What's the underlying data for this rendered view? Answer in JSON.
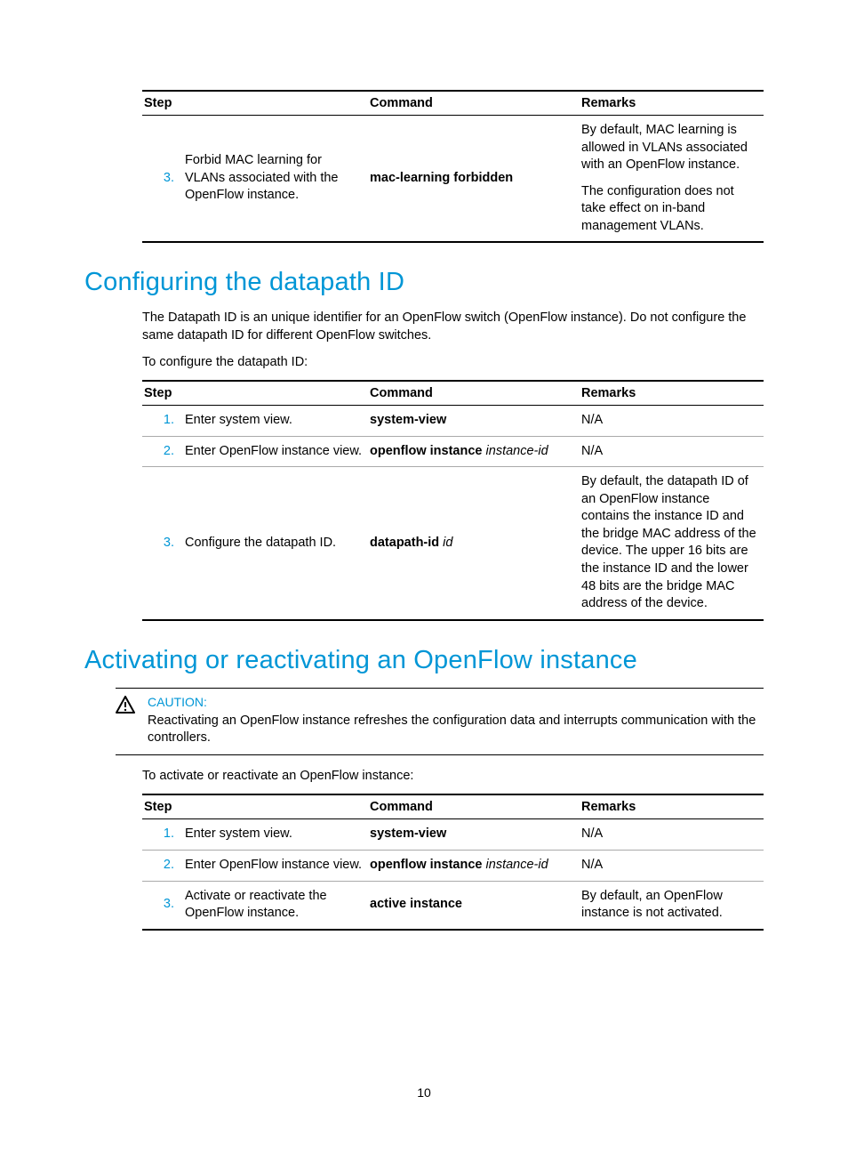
{
  "table1": {
    "headers": {
      "step": "Step",
      "command": "Command",
      "remarks": "Remarks"
    },
    "rows": [
      {
        "num": "3.",
        "step": "Forbid MAC learning for VLANs associated with the OpenFlow instance.",
        "cmd_bold": "mac-learning forbidden",
        "remarks_a": "By default, MAC learning is allowed in VLANs associated with an OpenFlow instance.",
        "remarks_b": "The configuration does not take effect on in-band management VLANs."
      }
    ]
  },
  "section1": {
    "heading": "Configuring the datapath ID",
    "para1": "The Datapath ID is an unique identifier for an OpenFlow switch (OpenFlow instance). Do not configure the same datapath ID for different OpenFlow switches.",
    "para2": "To configure the datapath ID:"
  },
  "table2": {
    "headers": {
      "step": "Step",
      "command": "Command",
      "remarks": "Remarks"
    },
    "rows": [
      {
        "num": "1.",
        "step": "Enter system view.",
        "cmd_bold": "system-view",
        "cmd_italic": "",
        "remarks": "N/A"
      },
      {
        "num": "2.",
        "step": "Enter OpenFlow instance view.",
        "cmd_bold": "openflow instance",
        "cmd_italic": " instance-id",
        "remarks": "N/A"
      },
      {
        "num": "3.",
        "step": "Configure the datapath ID.",
        "cmd_bold": "datapath-id",
        "cmd_italic": " id",
        "remarks": "By default, the datapath ID of an OpenFlow instance contains the instance ID and the bridge MAC address of the device. The upper 16 bits are the instance ID and the lower 48 bits are the bridge MAC address of the device."
      }
    ]
  },
  "section2": {
    "heading": "Activating or reactivating an OpenFlow instance",
    "caution_label": "CAUTION:",
    "caution_text": "Reactivating an OpenFlow instance refreshes the configuration data and interrupts communication with the controllers.",
    "para1": "To activate or reactivate an OpenFlow instance:"
  },
  "table3": {
    "headers": {
      "step": "Step",
      "command": "Command",
      "remarks": "Remarks"
    },
    "rows": [
      {
        "num": "1.",
        "step": "Enter system view.",
        "cmd_bold": "system-view",
        "cmd_italic": "",
        "remarks": "N/A"
      },
      {
        "num": "2.",
        "step": "Enter OpenFlow instance view.",
        "cmd_bold": "openflow instance",
        "cmd_italic": " instance-id",
        "remarks": "N/A"
      },
      {
        "num": "3.",
        "step": "Activate or reactivate the OpenFlow instance.",
        "cmd_bold": "active instance",
        "cmd_italic": "",
        "remarks": "By default, an OpenFlow instance is not activated."
      }
    ]
  },
  "page_number": "10"
}
